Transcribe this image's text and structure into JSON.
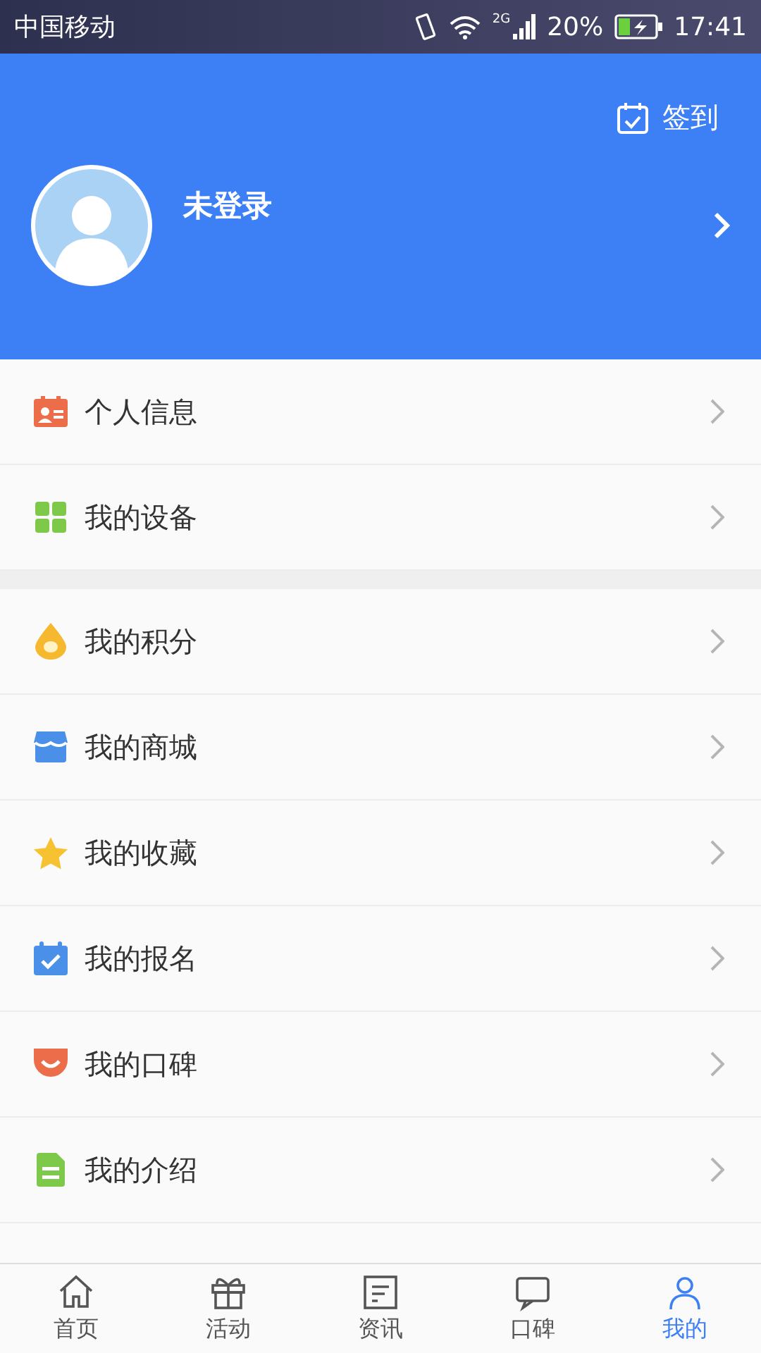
{
  "status_bar": {
    "carrier": "中国移动",
    "network": "2G",
    "battery": "20%",
    "time": "17:41"
  },
  "header": {
    "checkin": "签到",
    "username": "未登录"
  },
  "groups": [
    {
      "items": [
        {
          "label": "个人信息",
          "kind": "id-card"
        },
        {
          "label": "我的设备",
          "kind": "grid"
        }
      ]
    },
    {
      "items": [
        {
          "label": "我的积分",
          "kind": "drop"
        },
        {
          "label": "我的商城",
          "kind": "shop"
        },
        {
          "label": "我的收藏",
          "kind": "star"
        },
        {
          "label": "我的报名",
          "kind": "calendar"
        },
        {
          "label": "我的口碑",
          "kind": "smile"
        },
        {
          "label": "我的介绍",
          "kind": "doc"
        }
      ]
    }
  ],
  "tabs": [
    {
      "label": "首页",
      "kind": "home",
      "selected": false
    },
    {
      "label": "活动",
      "kind": "gift",
      "selected": false
    },
    {
      "label": "资讯",
      "kind": "news",
      "selected": false
    },
    {
      "label": "口碑",
      "kind": "chat",
      "selected": false
    },
    {
      "label": "我的",
      "kind": "user",
      "selected": true
    }
  ]
}
